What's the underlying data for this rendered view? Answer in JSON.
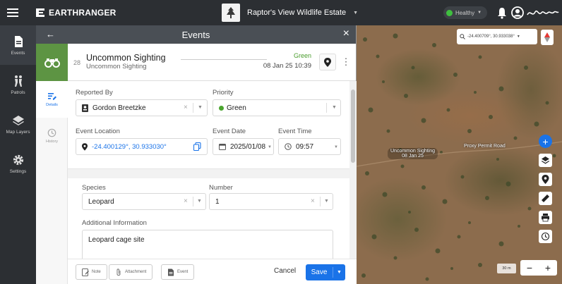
{
  "app": {
    "brand": "EARTHRANGER",
    "site_name": "Raptor's View Wildlife Estate",
    "health_label": "Healthy"
  },
  "nav": [
    {
      "label": "Events",
      "icon": "document-icon",
      "active": true
    },
    {
      "label": "Patrols",
      "icon": "patrol-icon",
      "active": false
    },
    {
      "label": "Map Layers",
      "icon": "layers-icon",
      "active": false
    },
    {
      "label": "Settings",
      "icon": "gear-icon",
      "active": false
    }
  ],
  "panel": {
    "title": "Events"
  },
  "event": {
    "serial": "28",
    "title": "Uncommon Sighting",
    "subtitle": "Uncommon Sighting",
    "priority_label": "Green",
    "datetime": "08 Jan 25 10:39"
  },
  "tabs": [
    {
      "label": "Details",
      "active": true
    },
    {
      "label": "History",
      "active": false
    }
  ],
  "form": {
    "reported_by_label": "Reported By",
    "reported_by_value": "Gordon Breetzke",
    "priority_label": "Priority",
    "priority_value": "Green",
    "location_label": "Event Location",
    "location_value": "-24.400129°, 30.933030°",
    "date_label": "Event Date",
    "date_value": "2025/01/08",
    "time_label": "Event Time",
    "time_value": "09:57",
    "species_label": "Species",
    "species_value": "Leopard",
    "number_label": "Number",
    "number_value": "1",
    "additional_info_label": "Additional Information",
    "additional_info_value": "Leopard cage site"
  },
  "footer": {
    "note_label": "Note",
    "attachment_label": "Attachment",
    "event_label": "Event",
    "cancel_label": "Cancel",
    "save_label": "Save"
  },
  "map": {
    "coord_search": "-24.400709°, 30.933038°",
    "marker_label_line1": "Uncommon Sighting",
    "marker_label_line2": "08 Jan 25",
    "area_label": "Proxy Permit Road",
    "scale_label": "30 m"
  },
  "colors": {
    "topbar": "#2c2f33",
    "panel_header": "#4a4f55",
    "event_icon_bg": "#5d9443",
    "priority_green": "#4aa52e",
    "accent_blue": "#1a73e8"
  }
}
